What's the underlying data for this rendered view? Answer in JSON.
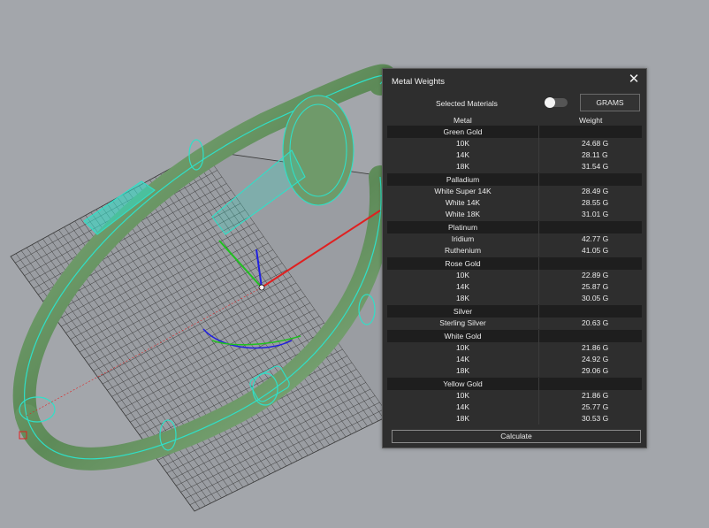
{
  "panel": {
    "title": "Metal Weights",
    "selected_materials_label": "Selected Materials",
    "selected_materials_on": false,
    "units_label": "GRAMS",
    "col_metal": "Metal",
    "col_weight": "Weight",
    "calculate_label": "Calculate",
    "close_icon": "close-icon",
    "groups": [
      {
        "name": "Green Gold",
        "rows": [
          {
            "name": "10K",
            "weight": "24.68 G"
          },
          {
            "name": "14K",
            "weight": "28.11 G"
          },
          {
            "name": "18K",
            "weight": "31.54 G"
          }
        ]
      },
      {
        "name": "Palladium",
        "rows": [
          {
            "name": "White Super 14K",
            "weight": "28.49 G"
          },
          {
            "name": "White 14K",
            "weight": "28.55 G"
          },
          {
            "name": "White 18K",
            "weight": "31.01 G"
          }
        ]
      },
      {
        "name": "Platinum",
        "rows": [
          {
            "name": "Iridium",
            "weight": "42.77 G"
          },
          {
            "name": "Ruthenium",
            "weight": "41.05 G"
          }
        ]
      },
      {
        "name": "Rose Gold",
        "rows": [
          {
            "name": "10K",
            "weight": "22.89 G"
          },
          {
            "name": "14K",
            "weight": "25.87 G"
          },
          {
            "name": "18K",
            "weight": "30.05 G"
          }
        ]
      },
      {
        "name": "Silver",
        "rows": [
          {
            "name": "Sterling Silver",
            "weight": "20.63 G"
          }
        ]
      },
      {
        "name": "White Gold",
        "rows": [
          {
            "name": "10K",
            "weight": "21.86 G"
          },
          {
            "name": "14K",
            "weight": "24.92 G"
          },
          {
            "name": "18K",
            "weight": "29.06 G"
          }
        ]
      },
      {
        "name": "Yellow Gold",
        "rows": [
          {
            "name": "10K",
            "weight": "21.86 G"
          },
          {
            "name": "14K",
            "weight": "25.77 G"
          },
          {
            "name": "18K",
            "weight": "30.53 G"
          }
        ]
      }
    ]
  },
  "colors": {
    "viewport_bg": "#a3a6ab",
    "ring": "#6f9a6a",
    "wire": "#2fe0c8",
    "grid": "#3a3a3a",
    "panel_bg": "#2e2e2e"
  }
}
